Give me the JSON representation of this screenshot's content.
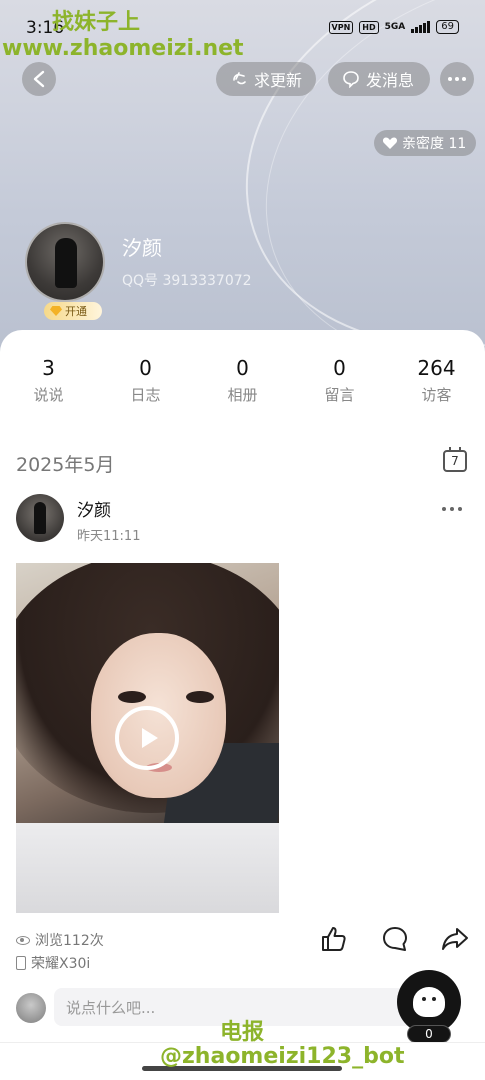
{
  "status_bar": {
    "time": "3:16",
    "vpn": "VPN",
    "hd": "HD",
    "network": "5GA",
    "battery": "69"
  },
  "watermark": {
    "top_line1": "找妹子上",
    "top_line2": "www.zhaomeizi.net",
    "bottom_line1": "电报",
    "bottom_line2": "@zhaomeizi123_bot"
  },
  "header": {
    "update_label": "求更新",
    "message_label": "发消息",
    "intimacy_label": "亲密度 11"
  },
  "profile": {
    "name": "汐颜",
    "qq": "QQ号 3913337072",
    "vip_label": "开通"
  },
  "stats": [
    {
      "value": "3",
      "label": "说说"
    },
    {
      "value": "0",
      "label": "日志"
    },
    {
      "value": "0",
      "label": "相册"
    },
    {
      "value": "0",
      "label": "留言"
    },
    {
      "value": "264",
      "label": "访客"
    }
  ],
  "feed": {
    "date_header": "2025年5月",
    "calendar_day": "7",
    "post": {
      "author": "汐颜",
      "time": "昨天11:11",
      "views": "浏览112次",
      "device": "荣耀X30i"
    },
    "comment_placeholder": "说点什么吧...",
    "fab_count": "0"
  },
  "icons": {
    "back": "chevron-left-icon",
    "update": "hand-icon",
    "message": "chat-bubble-icon",
    "more": "more-icon",
    "intimacy": "heart-icon",
    "calendar": "calendar-icon",
    "like": "thumbs-up-icon",
    "comment": "comment-icon",
    "share": "share-icon",
    "play": "play-icon"
  }
}
